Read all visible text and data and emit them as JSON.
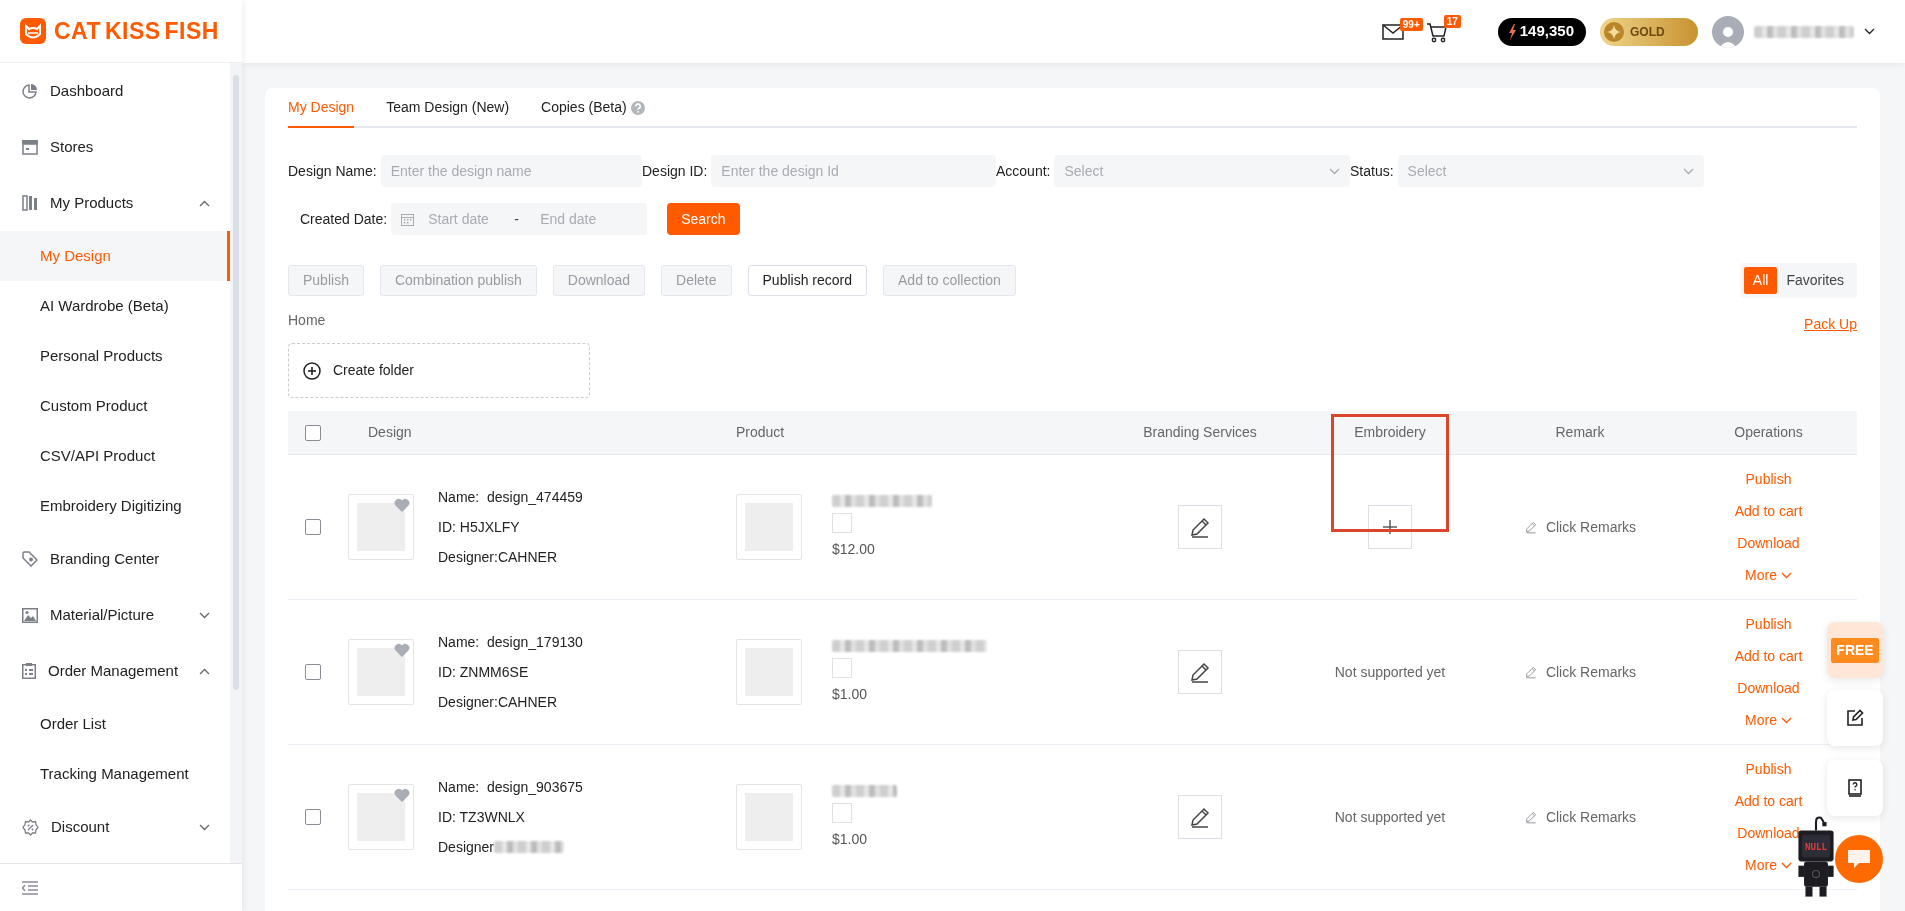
{
  "logo": {
    "text": "CAT KISS FISH"
  },
  "sidebar": {
    "items": [
      {
        "label": "Dashboard"
      },
      {
        "label": "Stores"
      },
      {
        "label": "My Products",
        "expanded": true,
        "children": [
          {
            "label": "My Design",
            "selected": true
          },
          {
            "label": "AI Wardrobe (Beta)",
            "selected": false
          },
          {
            "label": "Personal Products",
            "selected": false
          },
          {
            "label": "Custom Product",
            "selected": false
          },
          {
            "label": "CSV/API Product",
            "selected": false
          },
          {
            "label": "Embroidery Digitizing",
            "selected": false
          }
        ]
      },
      {
        "label": "Branding Center"
      },
      {
        "label": "Material/Picture",
        "expanded": false
      },
      {
        "label": "Order Management",
        "expanded": true,
        "children": [
          {
            "label": "Order List",
            "selected": false
          },
          {
            "label": "Tracking Management",
            "selected": false
          }
        ]
      },
      {
        "label": "Discount",
        "expanded": false
      }
    ]
  },
  "header": {
    "mail_badge": "99+",
    "cart_badge": "17",
    "points": "149,350",
    "level": "GOLD"
  },
  "tabs": [
    {
      "label": "My Design",
      "selected": true,
      "help": false
    },
    {
      "label": "Team Design (New)",
      "selected": false,
      "help": false
    },
    {
      "label": "Copies (Beta)",
      "selected": false,
      "help": true
    }
  ],
  "filters": [
    {
      "kind": "input",
      "label": "Design Name:",
      "placeholder": "Enter the design name"
    },
    {
      "kind": "input",
      "label": "Design ID:",
      "placeholder": "Enter the design Id"
    },
    {
      "kind": "select",
      "label": "Account:",
      "placeholder": "Select"
    },
    {
      "kind": "select",
      "label": "Status:",
      "placeholder": "Select"
    },
    {
      "kind": "daterange",
      "label": "Created Date:",
      "start_placeholder": "Start date",
      "separator": "-",
      "end_placeholder": "End date"
    }
  ],
  "search_button": "Search",
  "actions": [
    {
      "label": "Publish",
      "disabled": true
    },
    {
      "label": "Combination publish",
      "disabled": true
    },
    {
      "label": "Download",
      "disabled": true
    },
    {
      "label": "Delete",
      "disabled": true
    },
    {
      "label": "Publish record",
      "disabled": false
    },
    {
      "label": "Add to collection",
      "disabled": true
    }
  ],
  "view_toggle": [
    {
      "label": "All",
      "selected": true
    },
    {
      "label": "Favorites",
      "selected": false
    }
  ],
  "breadcrumb": "Home",
  "pack_up": "Pack Up",
  "create_folder": "Create folder",
  "table": {
    "select_all_checked": false,
    "columns": [
      {
        "label": "Design",
        "highlighted": false
      },
      {
        "label": "Product",
        "highlighted": false
      },
      {
        "label": "Branding Services",
        "highlighted": false
      },
      {
        "label": "Embroidery",
        "highlighted": true
      },
      {
        "label": "Remark",
        "highlighted": false
      },
      {
        "label": "Operations",
        "highlighted": false
      }
    ],
    "rows": [
      {
        "checked": false,
        "name": "Name:  design_474459",
        "id": "ID: H5JXLFY",
        "designer": "Designer:CAHNER",
        "designer_redacted": false,
        "price": "$12.00",
        "embroidery": {
          "kind": "add"
        },
        "remark": "Click Remarks",
        "operations": [
          {
            "label": "Publish",
            "kind": "link"
          },
          {
            "label": "Add to cart",
            "kind": "link"
          },
          {
            "label": "Download",
            "kind": "link"
          },
          {
            "label": "More",
            "kind": "menu"
          }
        ]
      },
      {
        "checked": false,
        "name": "Name:  design_179130",
        "id": "ID: ZNMM6SE",
        "designer": "Designer:CAHNER",
        "designer_redacted": false,
        "price": "$1.00",
        "embroidery": {
          "kind": "text",
          "text": "Not supported yet"
        },
        "remark": "Click Remarks",
        "operations": [
          {
            "label": "Publish",
            "kind": "link"
          },
          {
            "label": "Add to cart",
            "kind": "link"
          },
          {
            "label": "Download",
            "kind": "link"
          },
          {
            "label": "More",
            "kind": "menu"
          }
        ]
      },
      {
        "checked": false,
        "name": "Name:  design_903675",
        "id": "ID: TZ3WNLX",
        "designer": "Designer",
        "designer_redacted": true,
        "price": "$1.00",
        "embroidery": {
          "kind": "text",
          "text": "Not supported yet"
        },
        "remark": "Click Remarks",
        "operations": [
          {
            "label": "Publish",
            "kind": "link"
          },
          {
            "label": "Add to cart",
            "kind": "link"
          },
          {
            "label": "Download",
            "kind": "link"
          },
          {
            "label": "More",
            "kind": "menu"
          }
        ]
      }
    ]
  },
  "floating": {
    "free_badge": "FREE"
  },
  "mascot": {
    "screen_text": "NULL"
  }
}
